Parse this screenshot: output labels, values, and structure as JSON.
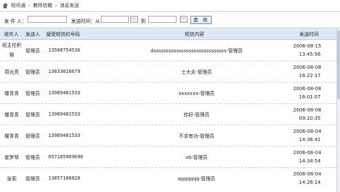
{
  "breadcrumb": [
    "校讯通",
    "教师信箱",
    "消息发送"
  ],
  "search": {
    "sender_label": "发 件 人：",
    "time_label": "发送时间：从",
    "to_label": "到",
    "dots_label": "···",
    "query_label": "查 询"
  },
  "table": {
    "headers": [
      "收件人",
      "发送人",
      "接受短信的号码",
      "短信内容",
      "发送时间"
    ],
    "rows": [
      {
        "recipient": "班主任积",
        "recipient2": "限",
        "sender": "管理员",
        "phone": "13588754536",
        "content": "dsssssssssssssssssssssssssssss-管理员",
        "date": "2006-08-15",
        "time": "13:45:56"
      },
      {
        "recipient": "项光亮",
        "sender": "管理员",
        "phone": "13033616679",
        "content": "士大夫-管理员",
        "date": "2006-08-08",
        "time": "16:22:17"
      },
      {
        "recipient": "楼青青",
        "sender": "管理员",
        "phone": "13989481533",
        "content": "xxxxxxx-管理员",
        "date": "2006-08-08",
        "time": "16:01:07"
      },
      {
        "recipient": "楼青青",
        "sender": "管理员",
        "phone": "13989481533",
        "content": "你好-管理员",
        "date": "2006-08-08",
        "time": "09:10:35"
      },
      {
        "recipient": "楼青青",
        "sender": "管理员",
        "phone": "13989481533",
        "content": "不求有功-管理员",
        "date": "2006-08-04",
        "time": "14:36:41"
      },
      {
        "recipient": "崔罗琴",
        "sender": "管理员",
        "phone": "057185969690",
        "content": "vb-管理员",
        "date": "2006-08-04",
        "time": "14:34:54"
      },
      {
        "recipient": "张莉",
        "sender": "管理员",
        "phone": "13857186828",
        "content": "qqqqqqq-管理员",
        "date": "2006-08-04",
        "time": "14:26:14"
      }
    ]
  }
}
